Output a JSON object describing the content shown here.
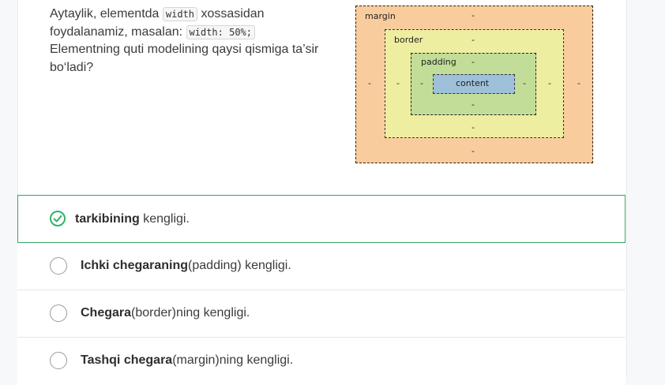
{
  "question": {
    "line1_pre": "Aytaylik, elementda ",
    "code1": "width",
    "line1_post": " xossasidan",
    "line2_pre": "foydalanamiz, masalan: ",
    "code2": "width: 50%;",
    "line3": "Elementning quti modelining qaysi qismiga ta’sir bo‘ladi?"
  },
  "diagram": {
    "margin_label": "margin",
    "border_label": "border",
    "padding_label": "padding",
    "content_label": "content",
    "dash": "-"
  },
  "options": [
    {
      "bold": "tarkibining",
      "rest": " kengligi.",
      "state": "correct"
    },
    {
      "bold": "Ichki chegaraning",
      "rest": "(padding) kengligi.",
      "state": "unselected"
    },
    {
      "bold": "Chegara",
      "rest": "(border)ning kengligi.",
      "state": "unselected"
    },
    {
      "bold": "Tashqi chegara",
      "rest": "(margin)ning kengligi.",
      "state": "unselected"
    }
  ],
  "colors": {
    "correct_green": "#2fb36a",
    "margin_fill": "#f9cc9d",
    "border_fill": "#eeeea0",
    "padding_fill": "#c2dd98",
    "content_fill": "#9ec0d9"
  }
}
